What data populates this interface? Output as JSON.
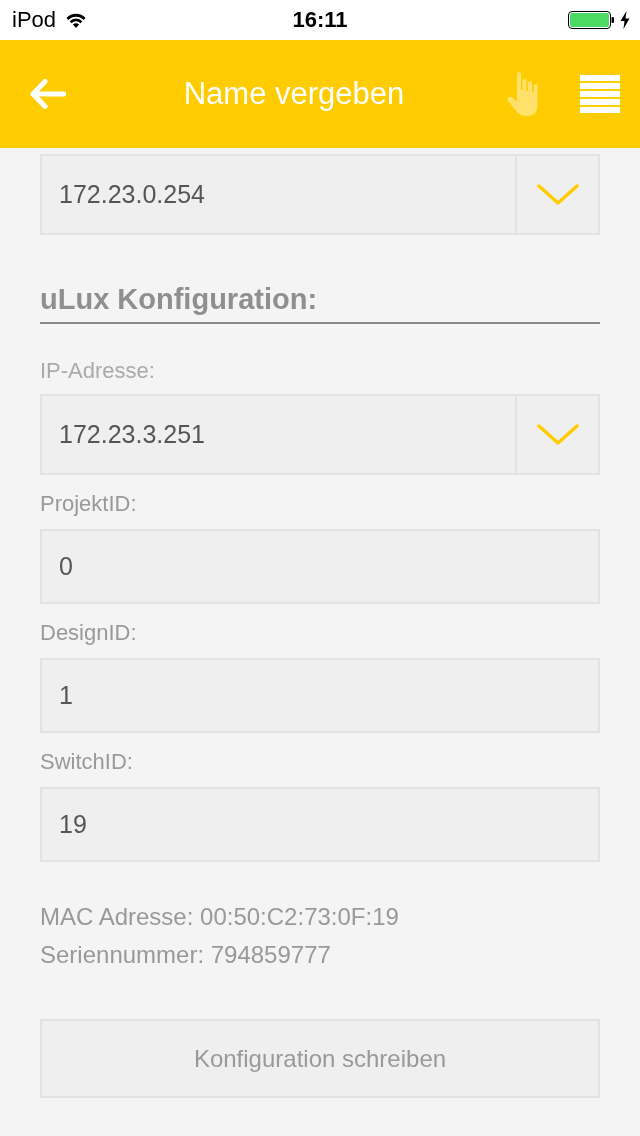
{
  "status_bar": {
    "carrier": "iPod",
    "time": "16:11"
  },
  "nav": {
    "title": "Name vergeben",
    "hand_button": {
      "disabled": true
    }
  },
  "gateway_select": {
    "value": "172.23.0.254"
  },
  "section": {
    "title": "uLux Konfiguration:"
  },
  "fields": [
    {
      "kind": "select",
      "label": "IP-Adresse:",
      "value": "172.23.3.251"
    },
    {
      "kind": "text",
      "label": "ProjektID:",
      "value": "0"
    },
    {
      "kind": "text",
      "label": "DesignID:",
      "value": "1"
    },
    {
      "kind": "text",
      "label": "SwitchID:",
      "value": "19"
    }
  ],
  "info": [
    "MAC Adresse: 00:50:C2:73:0F:19",
    "Seriennummer: 794859777"
  ],
  "write_button": {
    "label": "Konfiguration schreiben",
    "disabled": true
  }
}
